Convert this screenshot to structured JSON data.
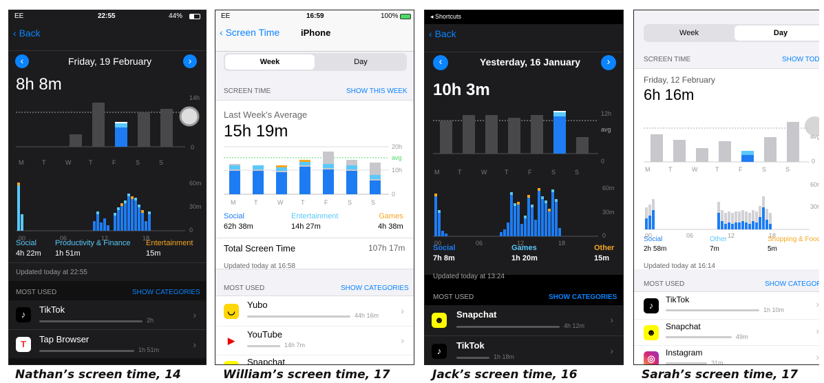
{
  "phones": [
    {
      "status": {
        "carrier": "EE",
        "time": "22:55",
        "battery": "44%"
      },
      "back": "Back",
      "date": "Friday, 19 February",
      "total": "8h 8m",
      "wk_ticks": [
        "14h",
        "0"
      ],
      "wk_days": [
        "M",
        "T",
        "W",
        "T",
        "F",
        "S",
        "S"
      ],
      "hr_ticks": [
        "60m",
        "30m",
        "0"
      ],
      "hr_x": [
        "00",
        "06",
        "12",
        "18"
      ],
      "cats": [
        {
          "name": "Social",
          "time": "4h 22m"
        },
        {
          "name": "Productivity & Finance",
          "time": "1h 51m"
        },
        {
          "name": "Entertainment",
          "time": "15m"
        }
      ],
      "updated": "Updated today at 22:55",
      "most_used": "MOST USED",
      "show_categories": "SHOW CATEGORIES",
      "apps": [
        {
          "name": "TikTok",
          "time": "2h",
          "icon": "tiktok-icon"
        },
        {
          "name": "Tap Browser",
          "time": "1h 51m",
          "icon": "tap-browser-icon"
        }
      ],
      "caption": "Nathan’s screen time, 14"
    },
    {
      "status": {
        "carrier": "EE",
        "time": "16:59",
        "battery": "100%"
      },
      "back": "Screen Time",
      "device": "iPhone",
      "seg": [
        "Week",
        "Day"
      ],
      "section": "SCREEN TIME",
      "show_week": "SHOW THIS WEEK",
      "avg_label": "Last Week's Average",
      "total": "15h 19m",
      "ticks": [
        "20h",
        "avg",
        "10h",
        "0"
      ],
      "days": [
        "M",
        "T",
        "W",
        "T",
        "F",
        "S",
        "S"
      ],
      "cats": [
        {
          "name": "Social",
          "time": "62h 38m"
        },
        {
          "name": "Entertainment",
          "time": "14h 27m"
        },
        {
          "name": "Games",
          "time": "4h 38m"
        }
      ],
      "total_label": "Total Screen Time",
      "total_value": "107h 17m",
      "updated": "Updated today at 16:58",
      "most_used": "MOST USED",
      "show_categories": "SHOW CATEGORIES",
      "apps": [
        {
          "name": "Yubo",
          "time": "44h 16m",
          "icon": "yubo-icon"
        },
        {
          "name": "YouTube",
          "time": "14h 7m",
          "icon": "youtube-icon"
        },
        {
          "name": "Snapchat",
          "time": "",
          "icon": "snapchat-icon"
        }
      ],
      "caption": "William’s screen time, 17"
    },
    {
      "status": {
        "back_app": "◂ Shortcuts"
      },
      "back": "Back",
      "date": "Yesterday, 16 January",
      "total": "10h 3m",
      "wk_ticks": [
        "12h",
        "avg",
        "0"
      ],
      "wk_days": [
        "M",
        "T",
        "W",
        "T",
        "F",
        "S",
        "S"
      ],
      "hr_ticks": [
        "60m",
        "30m",
        "0"
      ],
      "hr_x": [
        "00",
        "06",
        "12",
        "18"
      ],
      "cats": [
        {
          "name": "Social",
          "time": "7h 8m"
        },
        {
          "name": "Games",
          "time": "1h 20m"
        },
        {
          "name": "Other",
          "time": "15m"
        }
      ],
      "updated": "Updated today at 13:24",
      "most_used": "MOST USED",
      "show_categories": "SHOW CATEGORIES",
      "apps": [
        {
          "name": "Snapchat",
          "time": "4h 12m",
          "icon": "snapchat-icon"
        },
        {
          "name": "TikTok",
          "time": "1h 18m",
          "icon": "tiktok-icon"
        }
      ],
      "caption": "Jack’s screen time, 16"
    },
    {
      "seg": [
        "Week",
        "Day"
      ],
      "section": "SCREEN TIME",
      "show_today": "SHOW TODAY",
      "date": "Friday, 12 February",
      "total": "6h 16m",
      "wk_ticks": [
        "avg",
        "0"
      ],
      "wk_days": [
        "M",
        "T",
        "W",
        "T",
        "F",
        "S",
        "S"
      ],
      "hr_ticks": [
        "60m",
        "30m"
      ],
      "hr_x": [
        "00",
        "06",
        "12",
        "18"
      ],
      "cats": [
        {
          "name": "Social",
          "time": "2h 58m"
        },
        {
          "name": "Other",
          "time": "7m"
        },
        {
          "name": "Shopping & Food",
          "time": "5m"
        }
      ],
      "updated": "Updated today at 16:14",
      "most_used": "MOST USED",
      "show_categories": "SHOW CATEGORIES",
      "apps": [
        {
          "name": "TikTok",
          "time": "1h 10m",
          "icon": "tiktok-icon"
        },
        {
          "name": "Snapchat",
          "time": "49m",
          "icon": "snapchat-icon"
        },
        {
          "name": "Instagram",
          "time": "31m",
          "icon": "instagram-icon"
        }
      ],
      "caption": "Sarah’s screen time, 17"
    }
  ],
  "colors": {
    "social": "#1e7cf2",
    "entertainment": "#5ac8fa",
    "games": "#f5a623",
    "grey": "#8e8e93",
    "link_blue": "#0a84ff"
  }
}
